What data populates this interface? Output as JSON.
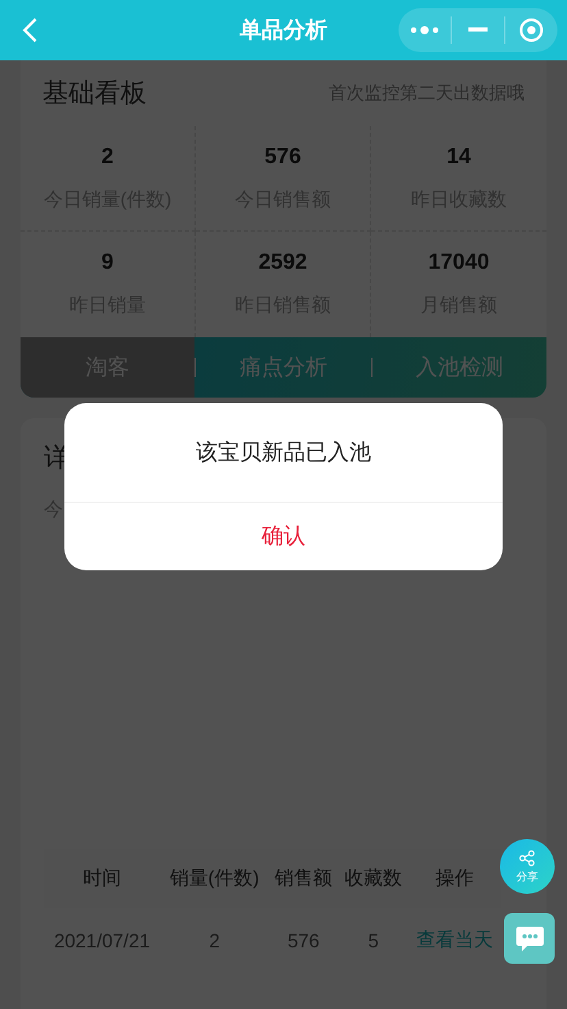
{
  "navbar": {
    "title": "单品分析"
  },
  "dashboard": {
    "title": "基础看板",
    "note": "首次监控第二天出数据哦",
    "stats": [
      {
        "value": "2",
        "label": "今日销量(件数)"
      },
      {
        "value": "576",
        "label": "今日销售额"
      },
      {
        "value": "14",
        "label": "昨日收藏数"
      },
      {
        "value": "9",
        "label": "昨日销量"
      },
      {
        "value": "2592",
        "label": "昨日销售额"
      },
      {
        "value": "17040",
        "label": "月销售额"
      }
    ],
    "tabs": [
      {
        "label": "淘客",
        "selected": true
      },
      {
        "label": "痛点分析",
        "selected": false
      },
      {
        "label": "入池检测",
        "selected": false
      }
    ]
  },
  "details": {
    "title": "详",
    "subtitle": "今",
    "table": {
      "columns": [
        "时间",
        "销量(件数)",
        "销售额",
        "收藏数",
        "操作"
      ],
      "rows": [
        [
          "2021/07/21",
          "2",
          "576",
          "5",
          "查看当天"
        ]
      ]
    }
  },
  "dialog": {
    "message": "该宝贝新品已入池",
    "confirm": "确认"
  },
  "share_button": {
    "label": "分享"
  }
}
